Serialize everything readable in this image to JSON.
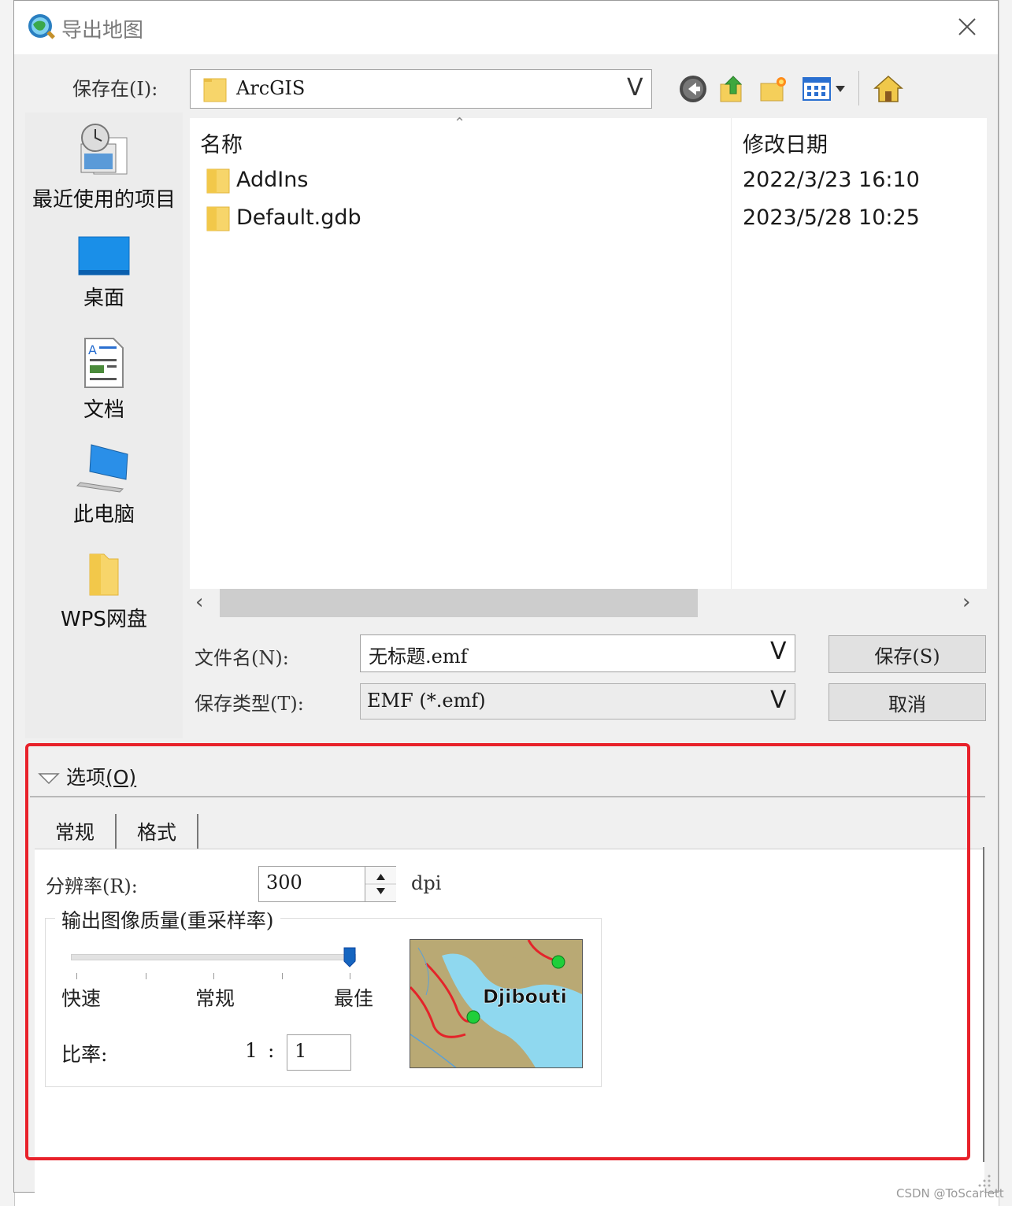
{
  "window": {
    "title": "导出地图",
    "close_icon": "close-icon"
  },
  "save_in": {
    "label": "保存在(I):",
    "value": "ArcGIS",
    "dropdown_glyph": "V"
  },
  "toolbar": {
    "buttons": [
      "back-icon",
      "up-folder-icon",
      "new-folder-icon",
      "view-menu-icon",
      "home-icon"
    ]
  },
  "places": [
    {
      "label": "最近使用的项目",
      "icon": "recent-items-icon"
    },
    {
      "label": "桌面",
      "icon": "desktop-icon"
    },
    {
      "label": "文档",
      "icon": "documents-icon"
    },
    {
      "label": "此电脑",
      "icon": "this-pc-icon"
    },
    {
      "label": "WPS网盘",
      "icon": "wps-cloud-icon"
    }
  ],
  "file_list": {
    "columns": {
      "name": "名称",
      "modified": "修改日期"
    },
    "rows": [
      {
        "name": "AddIns",
        "modified": "2022/3/23 16:10"
      },
      {
        "name": "Default.gdb",
        "modified": "2023/5/28 10:25"
      }
    ]
  },
  "file_name": {
    "label": "文件名(N):",
    "value": "无标题.emf"
  },
  "file_type": {
    "label": "保存类型(T):",
    "value": "EMF (*.emf)"
  },
  "buttons": {
    "save": "保存(S)",
    "cancel": "取消"
  },
  "options": {
    "expander_label": "选项",
    "expander_key": "(O)",
    "tabs": [
      "常规",
      "格式"
    ],
    "resolution": {
      "label": "分辨率(R):",
      "value": "300",
      "unit": "dpi"
    },
    "quality": {
      "title": "输出图像质量(重采样率)",
      "labels": [
        "快速",
        "常规",
        "最佳"
      ],
      "level": 1.0
    },
    "ratio": {
      "label": "比率:",
      "left": "1",
      "separator": ":",
      "value": "1"
    },
    "preview_label": "Djibouti"
  },
  "colors": {
    "highlight": "#e8212a",
    "folder": "#f7d56a",
    "slider_thumb": "#1565c0"
  },
  "watermark": "CSDN @ToScarlett"
}
